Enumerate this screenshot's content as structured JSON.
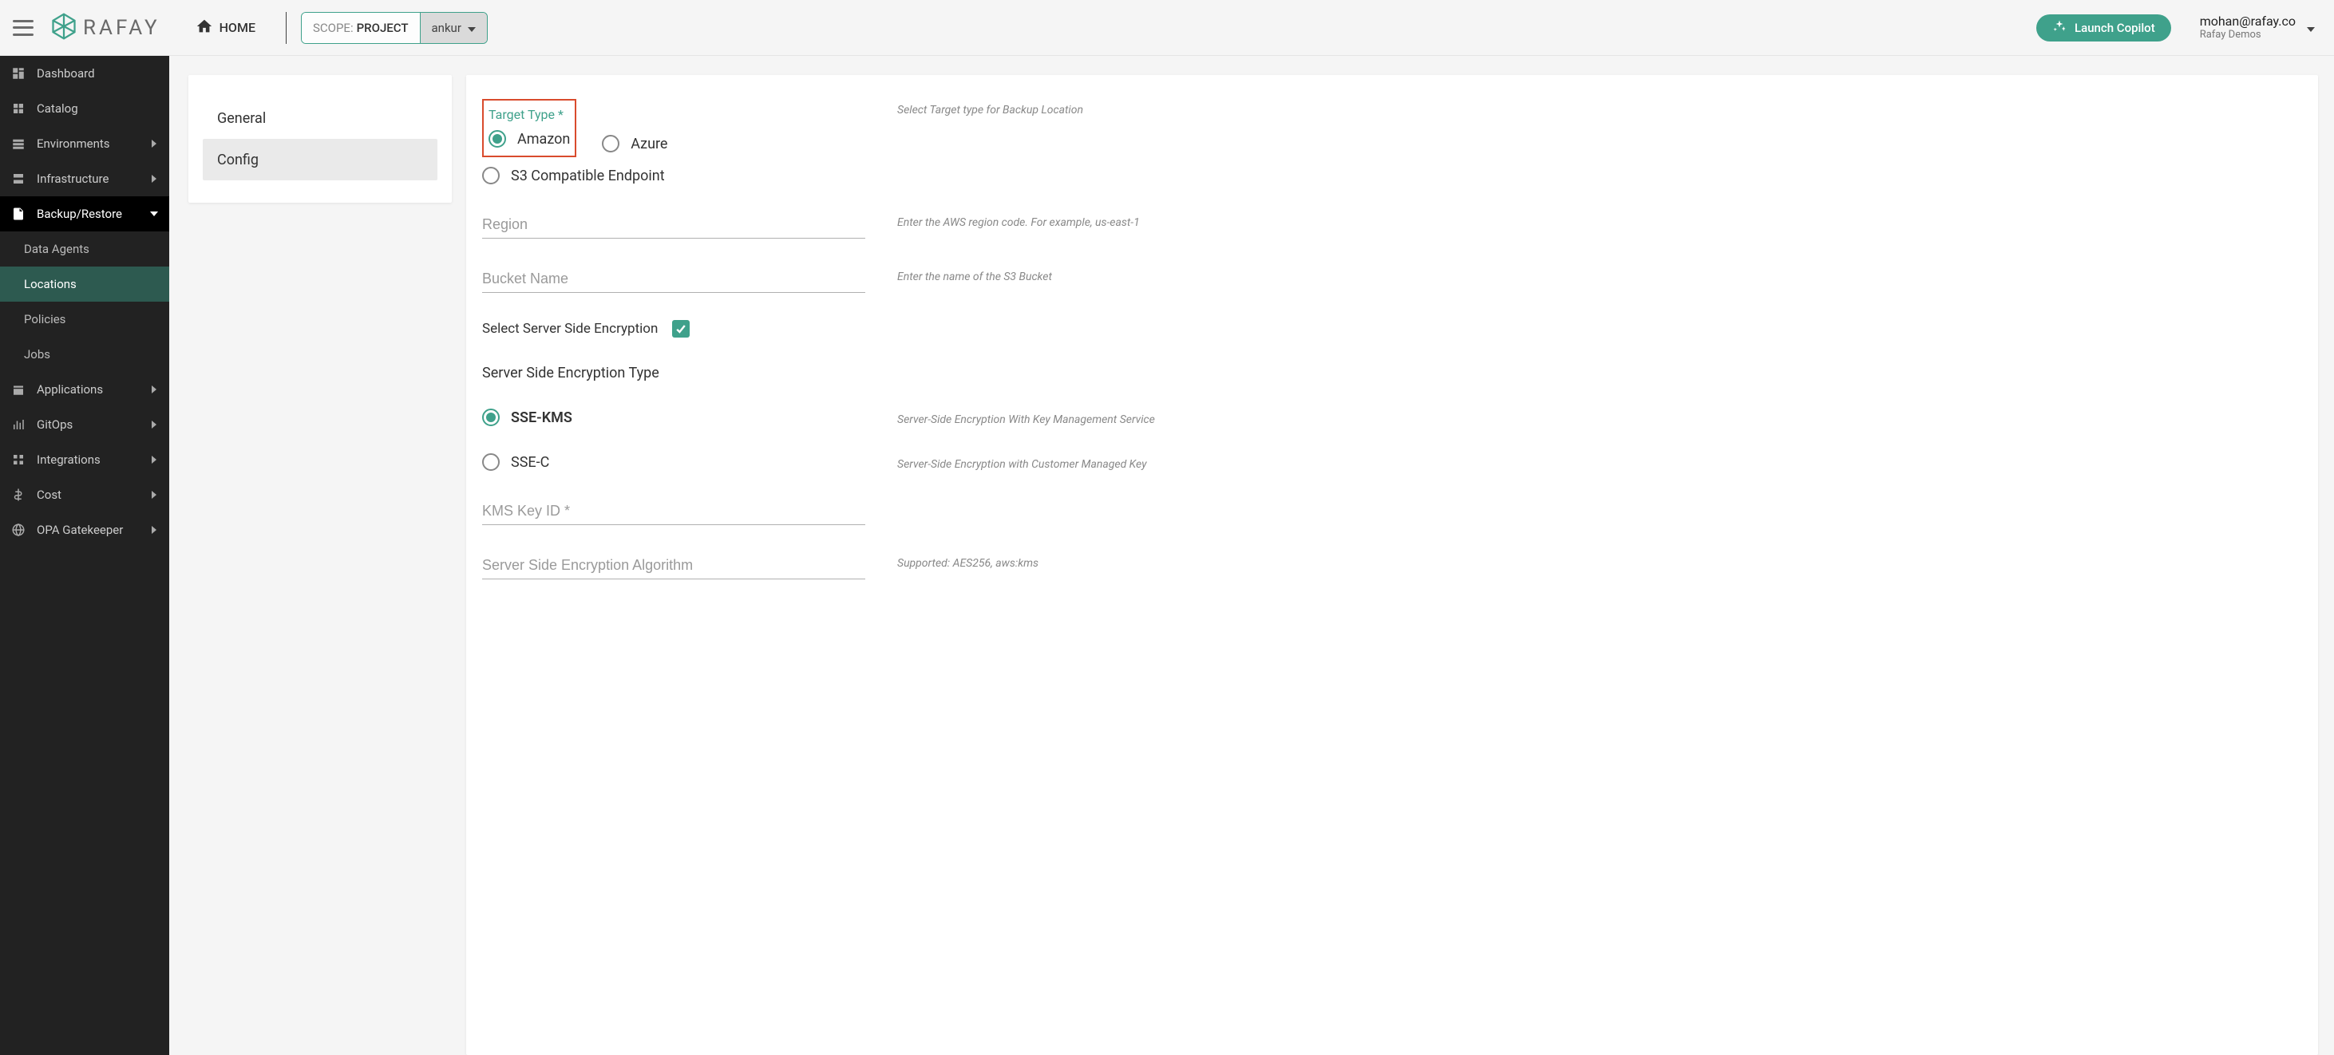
{
  "topbar": {
    "home_label": "HOME",
    "scope_prefix": "SCOPE:",
    "scope_value": "PROJECT",
    "scope_project": "ankur",
    "copilot_label": "Launch Copilot",
    "user_email": "mohan@rafay.co",
    "user_org": "Rafay Demos",
    "brand_text": "RAFAY"
  },
  "sidebar": {
    "items": [
      {
        "label": "Dashboard"
      },
      {
        "label": "Catalog"
      },
      {
        "label": "Environments"
      },
      {
        "label": "Infrastructure"
      },
      {
        "label": "Backup/Restore"
      },
      {
        "label": "Applications"
      },
      {
        "label": "GitOps"
      },
      {
        "label": "Integrations"
      },
      {
        "label": "Cost"
      },
      {
        "label": "OPA Gatekeeper"
      }
    ],
    "backup_sub": [
      {
        "label": "Data Agents"
      },
      {
        "label": "Locations"
      },
      {
        "label": "Policies"
      },
      {
        "label": "Jobs"
      }
    ]
  },
  "subtabs": {
    "general": "General",
    "config": "Config"
  },
  "form": {
    "target_type_label": "Target Type *",
    "target_type_help": "Select Target type for Backup Location",
    "target_amazon": "Amazon",
    "target_azure": "Azure",
    "target_s3compat": "S3 Compatible Endpoint",
    "region_placeholder": "Region",
    "region_help": "Enter the AWS region code. For example, us-east-1",
    "bucket_placeholder": "Bucket Name",
    "bucket_help": "Enter the name of the S3 Bucket",
    "sse_checkbox_label": "Select Server Side Encryption",
    "sse_type_label": "Server Side Encryption Type",
    "sse_kms_label": "SSE-KMS",
    "sse_kms_help": "Server-Side Encryption With Key Management Service",
    "sse_c_label": "SSE-C",
    "sse_c_help": "Server-Side Encryption with Customer Managed Key",
    "kms_key_placeholder": "KMS Key ID *",
    "sse_algo_placeholder": "Server Side Encryption Algorithm",
    "sse_algo_help": "Supported: AES256, aws:kms"
  }
}
